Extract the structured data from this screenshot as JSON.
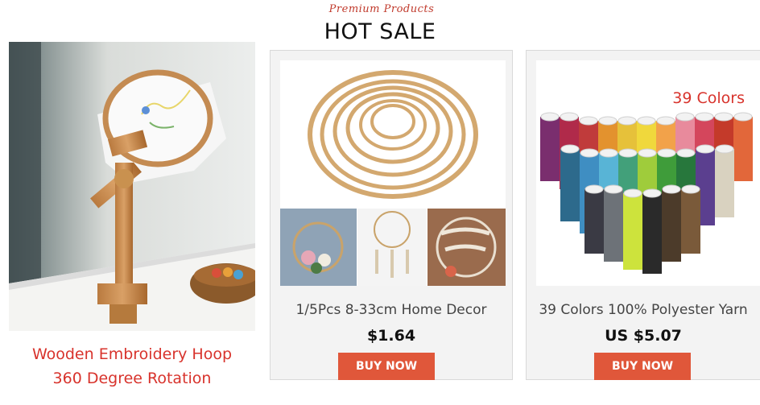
{
  "header": {
    "tagline": "Premium Products",
    "title": "HOT SALE"
  },
  "hero": {
    "caption_line1": "Wooden Embroidery Hoop",
    "caption_line2": "360 Degree Rotation"
  },
  "products": [
    {
      "title": "1/5Pcs 8-33cm Home Decor",
      "price": "$1.64",
      "button": "BUY NOW"
    },
    {
      "title": "39 Colors 100% Polyester Yarn",
      "price": "US $5.07",
      "button": "BUY NOW",
      "badge": "39 Colors"
    }
  ],
  "colors": {
    "accent_red": "#d8332c",
    "button_orange": "#e0573a"
  }
}
